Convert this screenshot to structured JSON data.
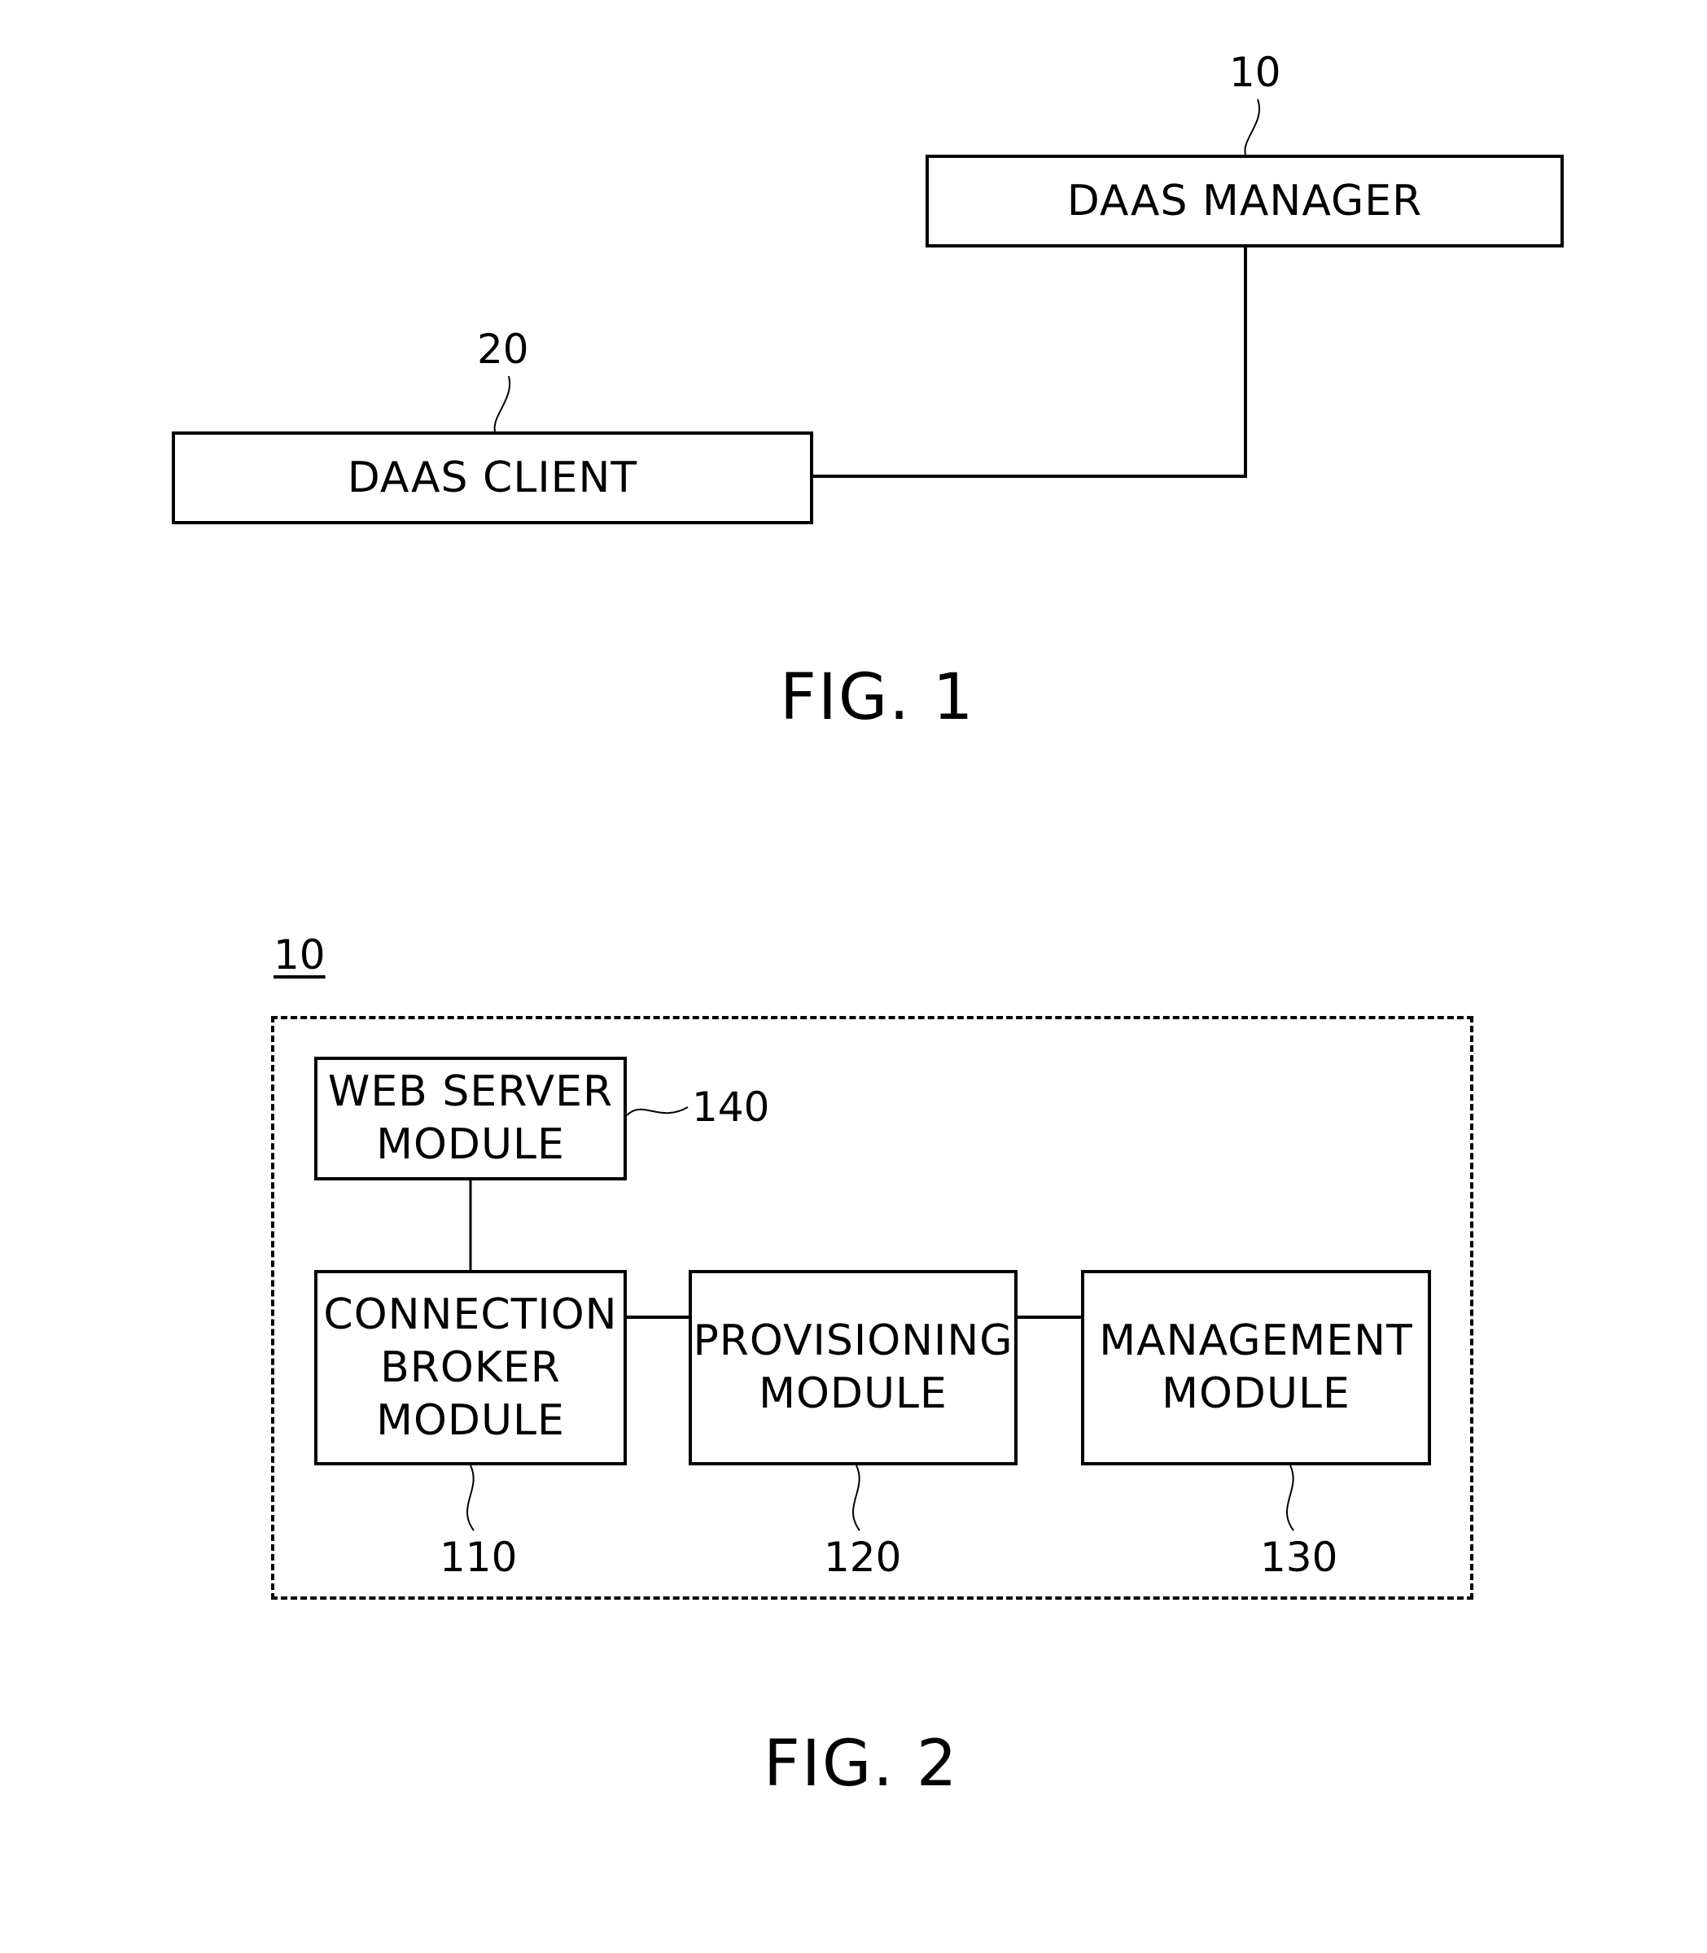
{
  "fig1": {
    "caption": "FIG. 1",
    "manager": {
      "label": "DAAS MANAGER",
      "ref": "10"
    },
    "client": {
      "label": "DAAS CLIENT",
      "ref": "20"
    }
  },
  "fig2": {
    "caption": "FIG. 2",
    "system_ref": "10",
    "modules": [
      {
        "label_lines": [
          "WEB SERVER",
          "MODULE"
        ],
        "ref": "140"
      },
      {
        "label_lines": [
          "CONNECTION",
          "BROKER",
          "MODULE"
        ],
        "ref": "110"
      },
      {
        "label_lines": [
          "PROVISIONING",
          "MODULE"
        ],
        "ref": "120"
      },
      {
        "label_lines": [
          "MANAGEMENT",
          "MODULE"
        ],
        "ref": "130"
      }
    ]
  }
}
